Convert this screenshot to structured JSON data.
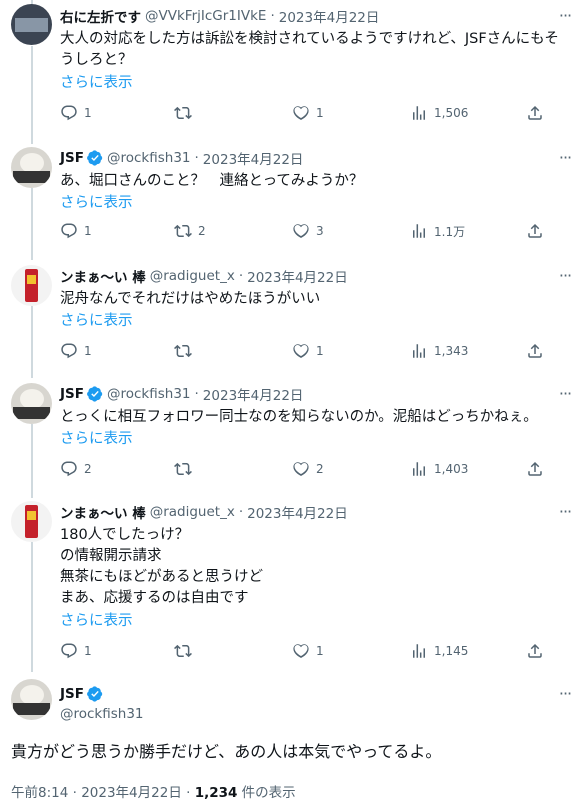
{
  "tweets": [
    {
      "name": "右に左折です",
      "handle": "@VVkFrjIcGr1IVkE",
      "date": "2023年4月22日",
      "text": "大人の対応をした方は訴訟を検討されているようですけれど、JSFさんにもそ\nうしろと？",
      "showmore": "さらに表示",
      "replies": "1",
      "retweets": "",
      "likes": "1",
      "views": "1,506"
    },
    {
      "name": "JSF",
      "handle": "@rockfish31",
      "date": "2023年4月22日",
      "text": "あ、堀口さんのこと？　連絡とってみようか？",
      "showmore": "さらに表示",
      "replies": "1",
      "retweets": "2",
      "likes": "3",
      "views": "1.1万"
    },
    {
      "name": "ンまぁ〜い 棒",
      "handle": "@radiguet_x",
      "date": "2023年4月22日",
      "text": "泥舟なんでそれだけはやめたほうがいい",
      "showmore": "さらに表示",
      "replies": "1",
      "retweets": "",
      "likes": "1",
      "views": "1,343"
    },
    {
      "name": "JSF",
      "handle": "@rockfish31",
      "date": "2023年4月22日",
      "text": "とっくに相互フォロワー同士なのを知らないのか。泥船はどっちかねぇ。",
      "showmore": "さらに表示",
      "replies": "2",
      "retweets": "",
      "likes": "2",
      "views": "1,403"
    },
    {
      "name": "ンまぁ〜い 棒",
      "handle": "@radiguet_x",
      "date": "2023年4月22日",
      "text": "180人でしたっけ？\nの情報開示請求\n無茶にもほどがあると思うけど\nまあ、応援するのは自由です",
      "showmore": "さらに表示",
      "replies": "1",
      "retweets": "",
      "likes": "1",
      "views": "1,145"
    }
  ],
  "main": {
    "name": "JSF",
    "handle": "@rockfish31",
    "text": "貴方がどう思うか勝手だけど、あの人は本気でやってるよ。",
    "time": "午前8:14 · 2023年4月22日 · ",
    "views_count": "1,234",
    "views_label": " 件の表示"
  },
  "colors": {
    "link": "#1d9bf0",
    "muted": "#536471",
    "text": "#0f1419",
    "thread": "#cfd9de"
  },
  "icons": [
    "reply-icon",
    "retweet-icon",
    "like-icon",
    "views-icon",
    "share-icon",
    "verified-icon",
    "more-icon"
  ]
}
